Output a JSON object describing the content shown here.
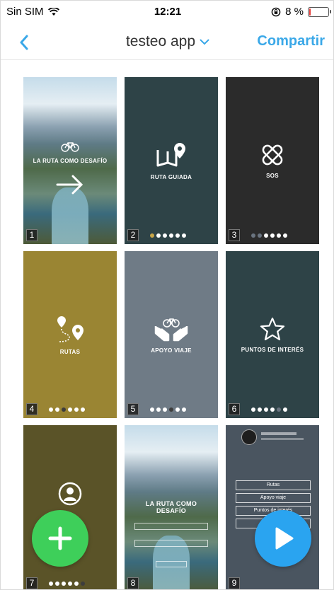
{
  "status_bar": {
    "carrier": "Sin SIM",
    "time": "12:21",
    "battery_text": "8 %",
    "battery_level": 0.08
  },
  "nav": {
    "title": "testeo app",
    "share_label": "Compartir",
    "accent_color": "#3aa8e8"
  },
  "cards": [
    {
      "number": "1",
      "title": "LA RUTA COMO DESAFÍO",
      "bg": "landscape"
    },
    {
      "number": "2",
      "title": "RUTA GUIADA",
      "bg": "#2e4347"
    },
    {
      "number": "3",
      "title": "SOS",
      "bg": "#2b2b2b"
    },
    {
      "number": "4",
      "title": "RUTAS",
      "bg": "#9a8533"
    },
    {
      "number": "5",
      "title": "APOYO VIAJE",
      "bg": "#6f7b86"
    },
    {
      "number": "6",
      "title": "PUNTOS DE INTERÉS",
      "bg": "#2e4347"
    },
    {
      "number": "7",
      "title": "",
      "bg": "#5a5328"
    },
    {
      "number": "8",
      "title": "LA RUTA COMO DESAFÍO",
      "bg": "landscape"
    },
    {
      "number": "9",
      "title": "",
      "bg": "#4a5560"
    }
  ],
  "card9_menu": [
    "Rutas",
    "Apoyo viaje",
    "Puntos de interés"
  ],
  "icons": {
    "back": "chevron-left-icon",
    "title_dropdown": "chevron-down-icon",
    "add": "plus-icon",
    "play": "play-icon"
  },
  "fab_colors": {
    "add": "#3ecf5a",
    "play": "#2aa4f0"
  }
}
